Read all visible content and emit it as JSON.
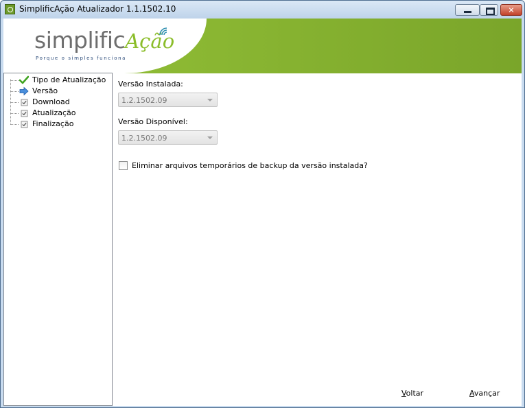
{
  "window": {
    "title": "SimplificAção Atualizador 1.1.1502.10"
  },
  "title_controls": {
    "minimize": "minimize-icon",
    "maximize": "maximize-icon",
    "close": "close-icon"
  },
  "banner": {
    "logo_main": "simplific",
    "logo_accent": "Ação",
    "tagline": "Porque o simples funciona",
    "brand_green": "#8bbd2a",
    "brand_gray": "#6e6e6e"
  },
  "steps": [
    {
      "label": "Tipo de Atualização",
      "state": "done",
      "icon": "green-check-icon"
    },
    {
      "label": "Versão",
      "state": "current",
      "icon": "blue-arrow-icon"
    },
    {
      "label": "Download",
      "state": "pending",
      "icon": "checkbox-icon"
    },
    {
      "label": "Atualização",
      "state": "pending",
      "icon": "checkbox-icon"
    },
    {
      "label": "Finalização",
      "state": "pending",
      "icon": "checkbox-icon"
    }
  ],
  "form": {
    "installed_label": "Versão Instalada:",
    "installed_value": "1.2.1502.09",
    "available_label": "Versão Disponível:",
    "available_value": "1.2.1502.09",
    "cleanup_label": "Eliminar arquivos temporários de backup da versão instalada?",
    "cleanup_checked": false
  },
  "buttons": {
    "back_access": "V",
    "back_rest": "oltar",
    "next_access": "A",
    "next_rest": "vançar"
  }
}
